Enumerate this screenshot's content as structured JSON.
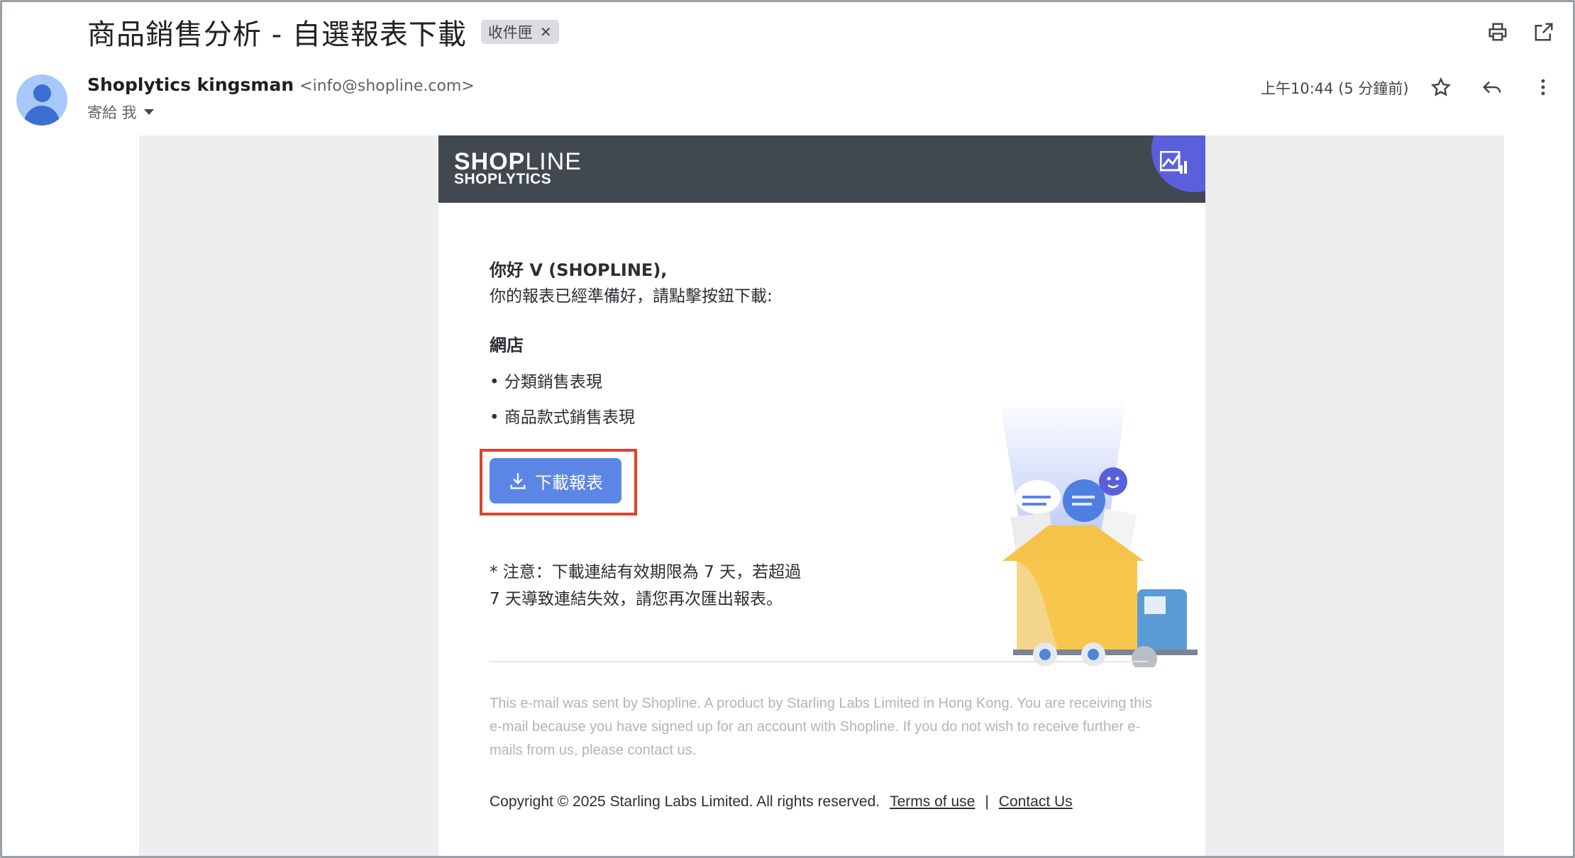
{
  "email": {
    "subject": "商品銷售分析 - 自選報表下載",
    "label": "收件匣",
    "sender_name": "Shoplytics kingsman",
    "sender_email": "<info@shopline.com>",
    "to_line": "寄給 我",
    "time": "上午10:44 (5 分鐘前)"
  },
  "icons": {
    "print": "print-icon",
    "open_new": "open-in-new-icon",
    "star": "star-icon",
    "reply": "reply-icon",
    "more": "more-vert-icon"
  },
  "banner": {
    "logo_bold": "SHOP",
    "logo_thin": "LINE",
    "sub": "SHOPLYTICS"
  },
  "body": {
    "greeting": "你好 V (SHOPLINE),",
    "intro": "你的報表已經準備好，請點擊按鈕下載:",
    "section_title": "網店",
    "items": [
      "• 分類銷售表現",
      "• 商品款式銷售表現"
    ],
    "download_label": "下載報表",
    "note_line1": "* 注意：下載連結有效期限為 7 天，若超過",
    "note_line2": "7 天導致連結失效，請您再次匯出報表。"
  },
  "footer": {
    "disclaimer": "This e-mail was sent by Shopline. A product by Starling Labs Limited in Hong Kong. You are receiving this e-mail because you have signed up for an account with Shopline. If you do not wish to receive further e-mails from us, please contact us.",
    "copyright": "Copyright © 2025 Starling Labs Limited. All rights reserved.",
    "terms": "Terms of use",
    "separator": "|",
    "contact": "Contact Us"
  },
  "colors": {
    "banner": "#414850",
    "button": "#5b86e5",
    "highlight": "#e0432a",
    "accent_purple": "#5a5fdc"
  }
}
